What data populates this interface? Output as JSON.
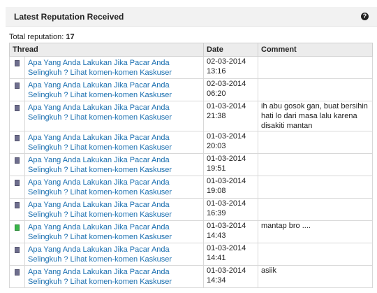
{
  "panel": {
    "title": "Latest Reputation Received",
    "help_glyph": "?"
  },
  "total": {
    "label": "Total reputation:",
    "value": "17"
  },
  "table": {
    "headers": {
      "thread": "Thread",
      "date": "Date",
      "comment": "Comment"
    },
    "rows": [
      {
        "icon": "neutral-rep-icon",
        "thread": "Apa Yang Anda Lakukan Jika Pacar Anda Selingkuh ? Lihat komen-komen Kaskuser",
        "date": "02-03-2014 13:16",
        "comment": ""
      },
      {
        "icon": "neutral-rep-icon",
        "thread": "Apa Yang Anda Lakukan Jika Pacar Anda Selingkuh ? Lihat komen-komen Kaskuser",
        "date": "02-03-2014 06:20",
        "comment": ""
      },
      {
        "icon": "neutral-rep-icon",
        "thread": "Apa Yang Anda Lakukan Jika Pacar Anda Selingkuh ? Lihat komen-komen Kaskuser",
        "date": "01-03-2014 21:38",
        "comment": "ih abu gosok gan, buat bersihin hati lo dari masa lalu karena disakiti mantan"
      },
      {
        "icon": "neutral-rep-icon",
        "thread": "Apa Yang Anda Lakukan Jika Pacar Anda Selingkuh ? Lihat komen-komen Kaskuser",
        "date": "01-03-2014 20:03",
        "comment": ""
      },
      {
        "icon": "neutral-rep-icon",
        "thread": "Apa Yang Anda Lakukan Jika Pacar Anda Selingkuh ? Lihat komen-komen Kaskuser",
        "date": "01-03-2014 19:51",
        "comment": ""
      },
      {
        "icon": "neutral-rep-icon",
        "thread": "Apa Yang Anda Lakukan Jika Pacar Anda Selingkuh ? Lihat komen-komen Kaskuser",
        "date": "01-03-2014 19:08",
        "comment": ""
      },
      {
        "icon": "neutral-rep-icon",
        "thread": "Apa Yang Anda Lakukan Jika Pacar Anda Selingkuh ? Lihat komen-komen Kaskuser",
        "date": "01-03-2014 16:39",
        "comment": ""
      },
      {
        "icon": "positive-rep-icon",
        "thread": "Apa Yang Anda Lakukan Jika Pacar Anda Selingkuh ? Lihat komen-komen Kaskuser",
        "date": "01-03-2014 14:43",
        "comment": "mantap bro ...."
      },
      {
        "icon": "neutral-rep-icon",
        "thread": "Apa Yang Anda Lakukan Jika Pacar Anda Selingkuh ? Lihat komen-komen Kaskuser",
        "date": "01-03-2014 14:41",
        "comment": ""
      },
      {
        "icon": "neutral-rep-icon",
        "thread": "Apa Yang Anda Lakukan Jika Pacar Anda Selingkuh ? Lihat komen-komen Kaskuser",
        "date": "01-03-2014 14:34",
        "comment": "asiik"
      }
    ]
  },
  "colors": {
    "link": "#1a6fb0",
    "header_bg": "#f2f2f2",
    "positive": "#39b54a",
    "neutral": "#6e6e8e"
  }
}
